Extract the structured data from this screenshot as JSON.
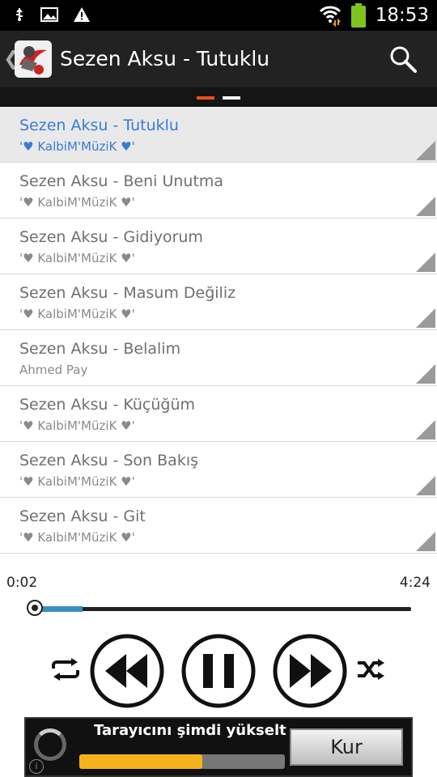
{
  "status_bar": {
    "time": "18:53",
    "icons": [
      "usb-icon",
      "image-icon",
      "warning-icon",
      "wifi-icon",
      "battery-icon"
    ]
  },
  "header": {
    "title": "Sezen Aksu - Tutuklu",
    "icons": [
      "back-chevron-icon",
      "app-logo-icon",
      "search-icon"
    ]
  },
  "pager": {
    "pages": 2,
    "current": 1,
    "accent": "#e8521e"
  },
  "tracks": [
    {
      "title": "Sezen Aksu - Tutuklu",
      "subtitle": "'♥ KalbiM'MüziK ♥'",
      "active": true
    },
    {
      "title": "Sezen Aksu - Beni Unutma",
      "subtitle": "'♥ KalbiM'MüziK ♥'"
    },
    {
      "title": "Sezen Aksu - Gidiyorum",
      "subtitle": "'♥ KalbiM'MüziK ♥'"
    },
    {
      "title": "Sezen Aksu - Masum Değiliz",
      "subtitle": "'♥ KalbiM'MüziK ♥'"
    },
    {
      "title": "Sezen Aksu - Belalim",
      "subtitle": "Ahmed Pay"
    },
    {
      "title": "Sezen Aksu - Küçüğüm",
      "subtitle": "'♥ KalbiM'MüziK ♥'"
    },
    {
      "title": "Sezen Aksu - Son Bakış",
      "subtitle": "'♥ KalbiM'MüziK ♥'"
    },
    {
      "title": "Sezen Aksu - Git",
      "subtitle": "'♥ KalbiM'MüziK ♥'"
    }
  ],
  "player": {
    "current_time": "0:02",
    "total_time": "4:24",
    "progress": 0.14,
    "controls": [
      "repeat-icon",
      "rewind-icon",
      "pause-icon",
      "fast-forward-icon",
      "shuffle-icon"
    ]
  },
  "ad": {
    "text": "Tarayıcını şimdi yükselt",
    "button": "Kur",
    "info": "i",
    "progress": 0.6
  },
  "colors": {
    "accent": "#3a7bd5",
    "seek": "#3a8fc2",
    "ad_bar": "#f5b21b"
  }
}
